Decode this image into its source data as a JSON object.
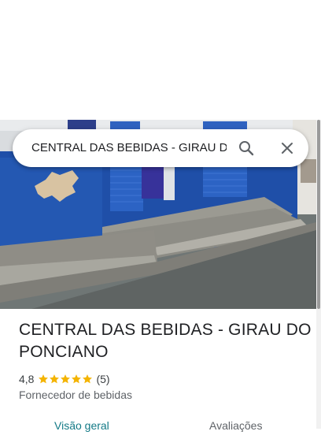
{
  "search": {
    "query": "CENTRAL DAS BEBIDAS - GIRAU DO PONCIANO"
  },
  "place": {
    "title": "CENTRAL DAS BEBIDAS - GIRAU DO PONCIANO",
    "rating": "4,8",
    "stars_filled": 5,
    "reviews_count": "(5)",
    "category": "Fornecedor de bebidas"
  },
  "tabs": [
    {
      "label": "Visão geral",
      "active": true
    },
    {
      "label": "Avaliações",
      "active": false
    }
  ],
  "colors": {
    "star": "#f4b400",
    "active_tab": "#137a86",
    "wall_blue": "#1f4fa8"
  },
  "icons": [
    "search-icon",
    "close-icon",
    "star-icon"
  ]
}
